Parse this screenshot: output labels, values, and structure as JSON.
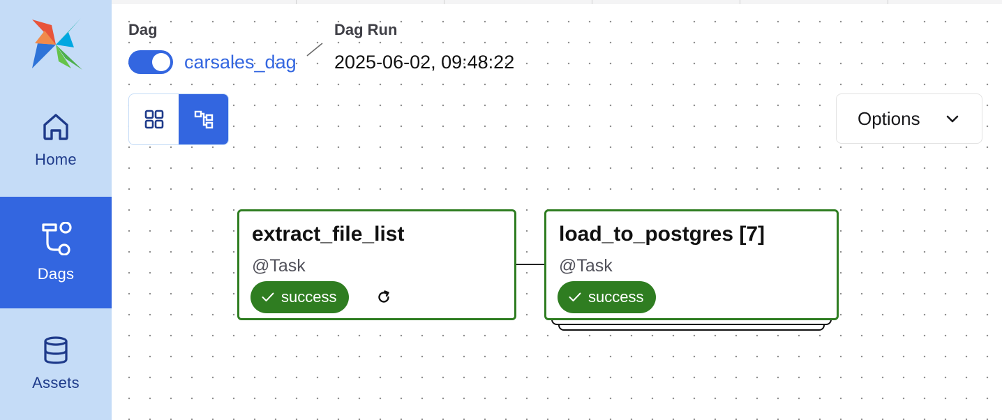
{
  "sidebar": {
    "logo": "airflow-pinwheel-logo",
    "items": [
      {
        "label": "Home",
        "icon": "home-icon",
        "active": false
      },
      {
        "label": "Dags",
        "icon": "dags-icon",
        "active": true
      },
      {
        "label": "Assets",
        "icon": "database-icon",
        "active": false
      }
    ]
  },
  "header": {
    "dag_title": "Dag",
    "dag_name": "carsales_dag",
    "dag_enabled": true,
    "run_title": "Dag Run",
    "run_value": "2025-06-02, 09:48:22"
  },
  "toolbar": {
    "views": [
      {
        "icon": "grid-view-icon",
        "active": false
      },
      {
        "icon": "graph-view-icon",
        "active": true
      }
    ],
    "options_label": "Options",
    "options_icon": "chevron-down-icon"
  },
  "graph": {
    "nodes": [
      {
        "name": "extract_file_list",
        "type": "@Task",
        "status": "success",
        "has_retry": true
      },
      {
        "name": "load_to_postgres [7]",
        "type": "@Task",
        "status": "success",
        "has_retry": false
      }
    ]
  },
  "colors": {
    "sidebar_bg": "#c5dcf7",
    "accent": "#3366e0",
    "success": "#2f7d21",
    "nav_text": "#1e3a8a"
  }
}
